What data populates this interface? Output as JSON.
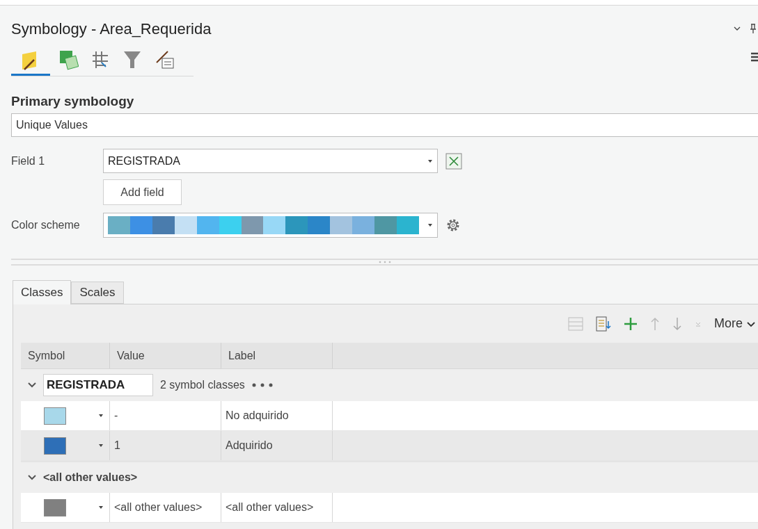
{
  "window": {
    "title": "Symbology - Area_Requerida"
  },
  "view_tabs": [
    {
      "kind": "polygon",
      "selected": true
    },
    {
      "kind": "layers",
      "selected": false
    },
    {
      "kind": "grid",
      "selected": false
    },
    {
      "kind": "filter",
      "selected": false
    },
    {
      "kind": "label",
      "selected": false
    }
  ],
  "primary_symbology": {
    "heading": "Primary symbology",
    "value": "Unique Values"
  },
  "field_1": {
    "label": "Field 1",
    "value": "REGISTRADA"
  },
  "add_field_button": "Add field",
  "color_scheme": {
    "label": "Color scheme",
    "swatches": [
      {
        "color": "#6aafc4"
      },
      {
        "color": "#3d90e4"
      },
      {
        "color": "#4a7cad"
      },
      {
        "color": "#c4e0f4"
      },
      {
        "color": "#52b5ef"
      },
      {
        "color": "#3cd0ef"
      },
      {
        "color": "#7e98ad"
      },
      {
        "color": "#98d8f6"
      },
      {
        "color": "#2c96bb"
      },
      {
        "color": "#2b86c8"
      },
      {
        "color": "#a3c3df"
      },
      {
        "color": "#7ab1de"
      },
      {
        "color": "#4f97a3"
      },
      {
        "color": "#2bb4cf"
      }
    ]
  },
  "tabs": [
    {
      "label": "Classes",
      "selected": true
    },
    {
      "label": "Scales",
      "selected": false
    }
  ],
  "toolbar": {
    "more": "More"
  },
  "table": {
    "columns": [
      "Symbol",
      "Value",
      "Label"
    ],
    "groups": [
      {
        "name": "REGISTRADA",
        "kind": "field",
        "count": "2 symbol classes",
        "expanded": true,
        "rows": [
          {
            "color": "#a8d8ea",
            "value": "-",
            "label": "No adquirido",
            "selected": false
          },
          {
            "color": "#2e6fb7",
            "value": "1",
            "label": "Adquirido",
            "selected": true
          }
        ]
      },
      {
        "name": "<all other values>",
        "kind": "other",
        "expanded": true,
        "rows": [
          {
            "color": "#808080",
            "value": "<all other values>",
            "label": "<all other values>",
            "selected": false
          }
        ]
      }
    ]
  }
}
